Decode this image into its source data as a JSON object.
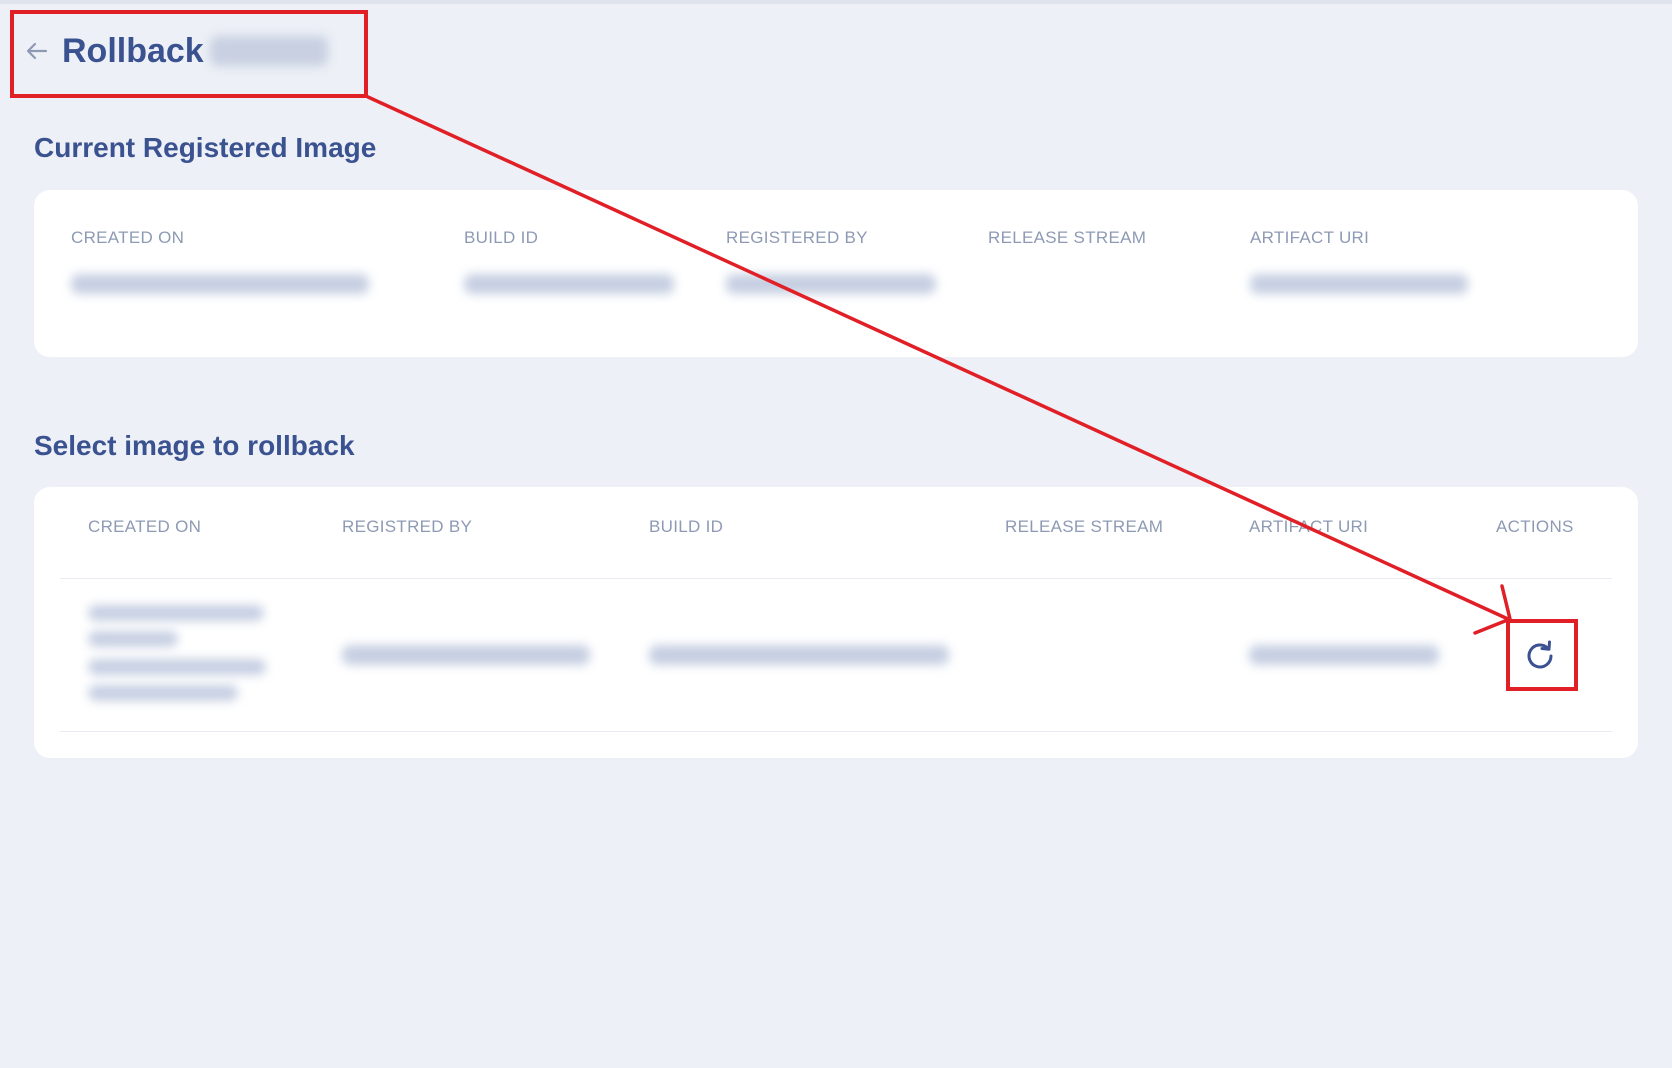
{
  "header": {
    "title": "Rollback",
    "back_icon": "arrow-left-icon"
  },
  "current": {
    "section_title": "Current Registered Image",
    "columns": [
      "CREATED ON",
      "BUILD ID",
      "REGISTERED BY",
      "RELEASE STREAM",
      "ARTIFACT URI"
    ]
  },
  "select": {
    "section_title": "Select image to rollback",
    "columns": [
      "CREATED ON",
      "REGISTRED BY",
      "BUILD ID",
      "RELEASE STREAM",
      "ARTIFACT URI",
      "ACTIONS"
    ],
    "row_action_icon": "rotate-cw-icon"
  },
  "colors": {
    "background": "#edf0f6",
    "title": "#3b5290",
    "header_text": "#8e9ab4",
    "annotation": "#e01f27"
  }
}
